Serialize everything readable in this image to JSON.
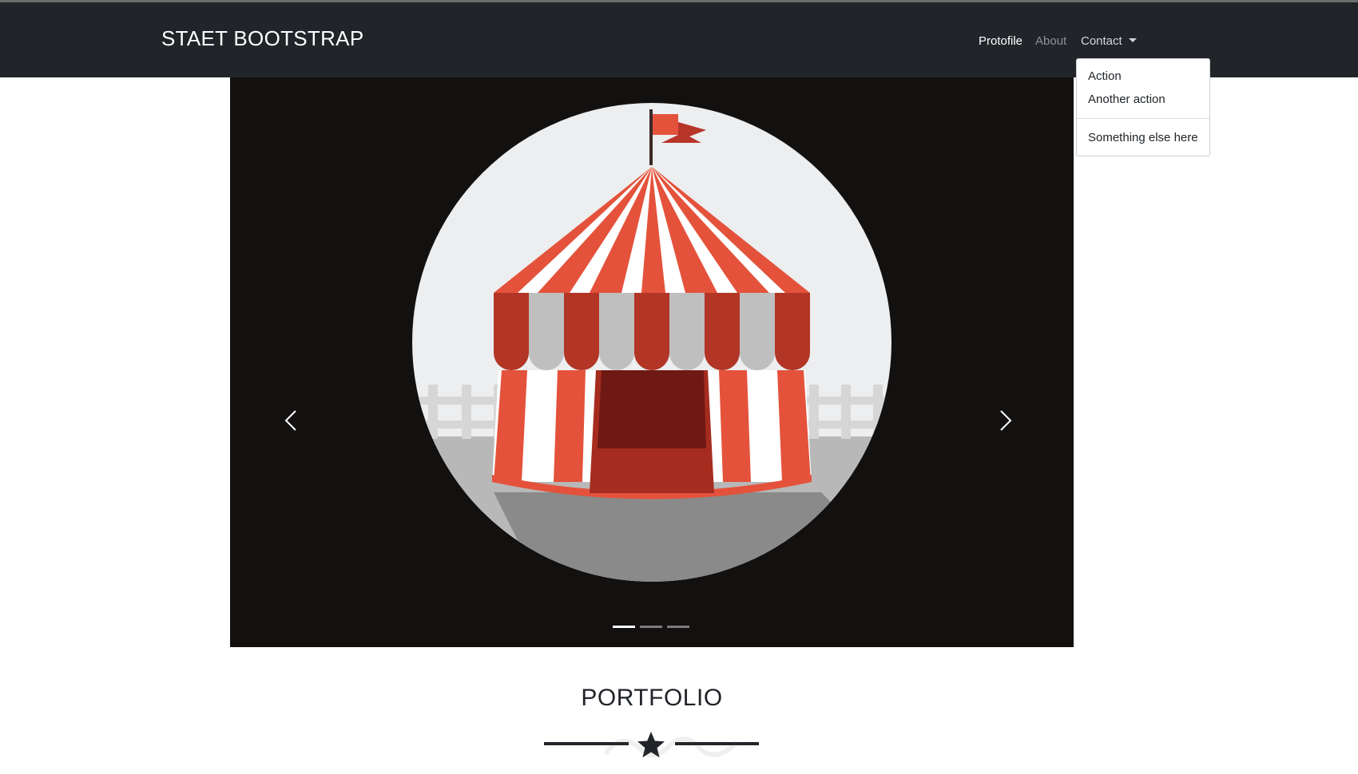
{
  "navbar": {
    "brand": "STAET BOOTSTRAP",
    "links": [
      {
        "label": "Protofile",
        "active": true
      },
      {
        "label": "About",
        "active": false
      },
      {
        "label": "Contact",
        "active": false,
        "has_dropdown": true
      }
    ]
  },
  "dropdown": {
    "items": [
      {
        "label": "Action"
      },
      {
        "label": "Another action"
      },
      {
        "label": "Something else here"
      }
    ]
  },
  "carousel": {
    "slide_count": 3,
    "active_slide": 1,
    "prev_icon": "chevron-left-icon",
    "next_icon": "chevron-right-icon",
    "slide_image": "circus-tent-illustration"
  },
  "portfolio": {
    "title": "PORTFOLIO",
    "divider_icon": "star-icon"
  },
  "colors": {
    "navbar_bg": "#212429",
    "carousel_bg": "#131010",
    "tent_red": "#e4523b",
    "tent_dark_red": "#b23526",
    "text_dark": "#212529"
  }
}
